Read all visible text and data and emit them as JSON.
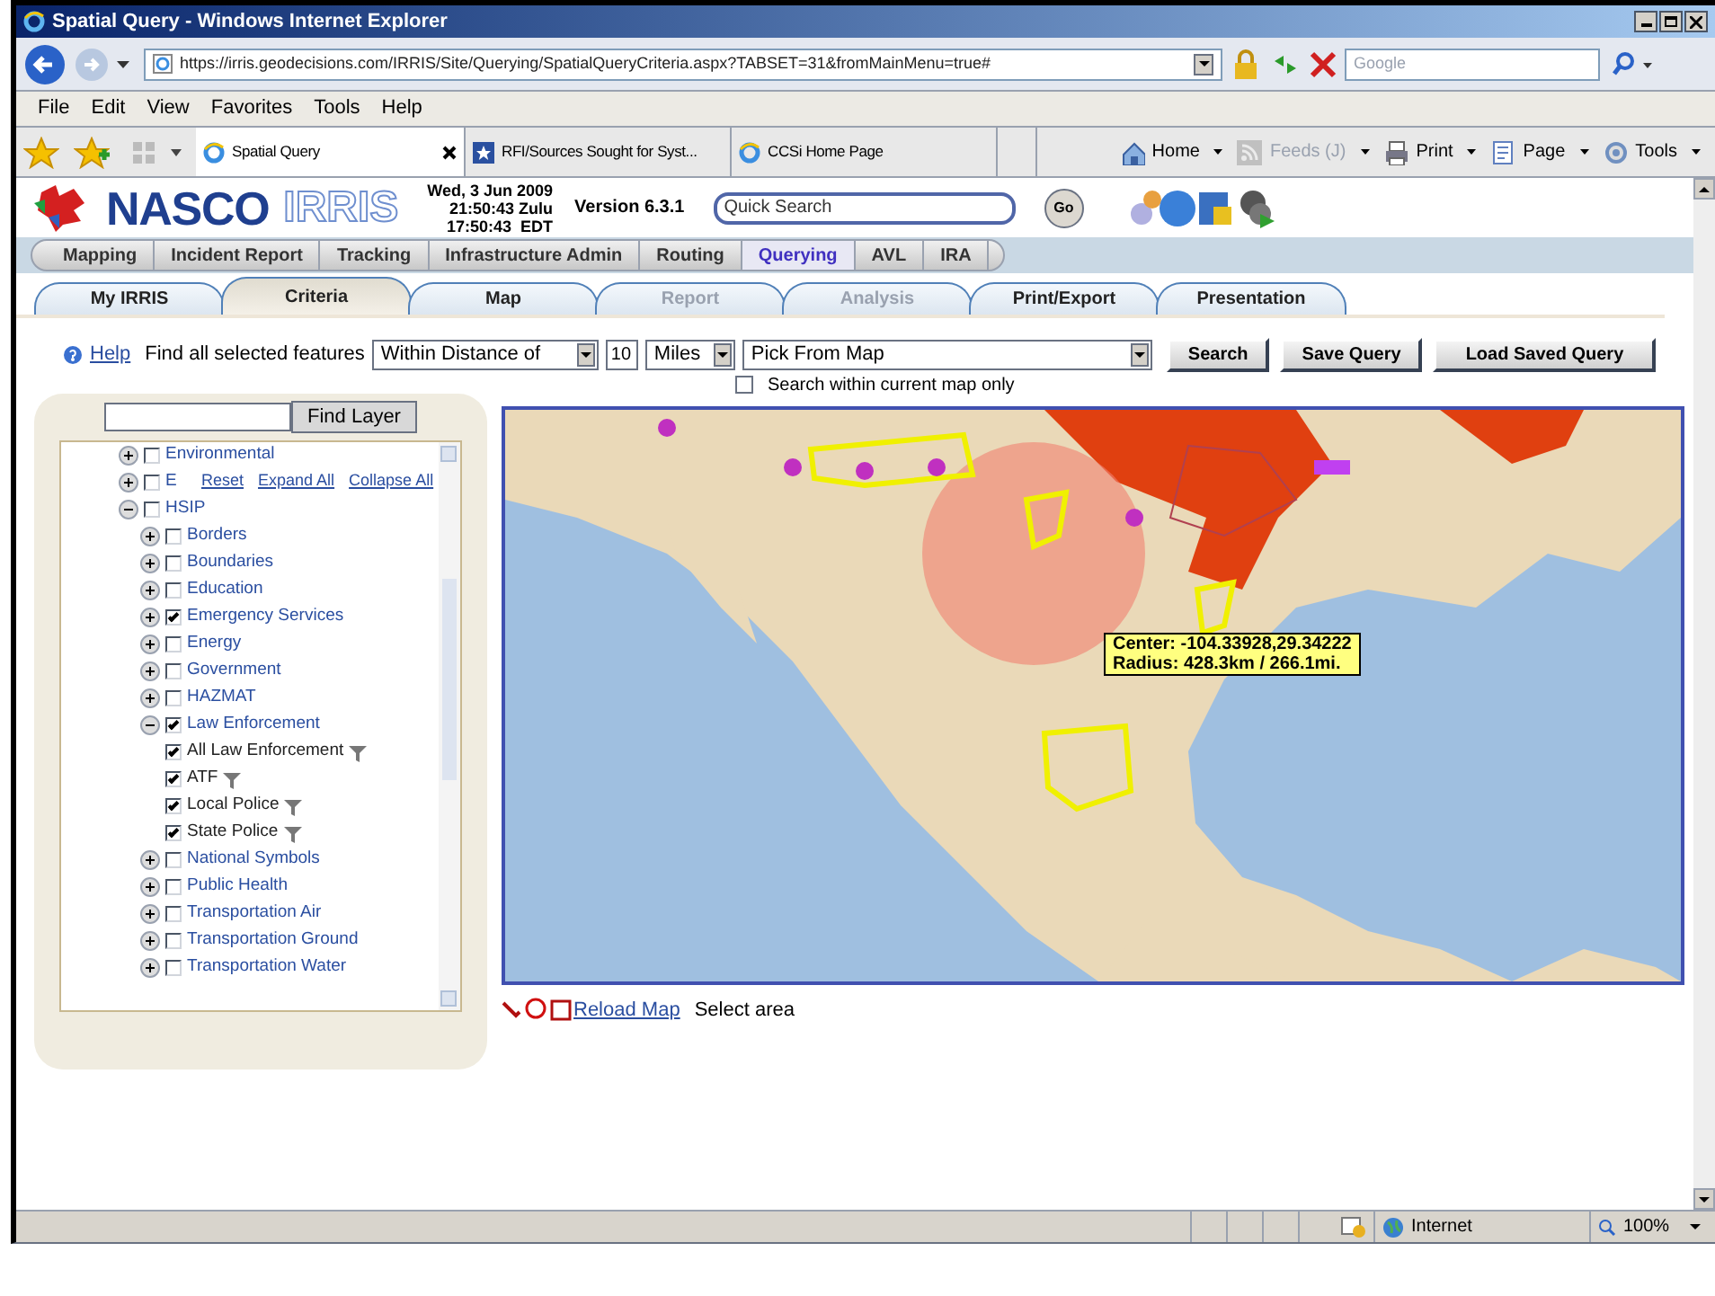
{
  "window": {
    "title": "Spatial Query - Windows Internet Explorer"
  },
  "address_bar": {
    "url": "https://irris.geodecisions.com/IRRIS/Site/Querying/SpatialQueryCriteria.aspx?TABSET=31&fromMainMenu=true#",
    "search_placeholder": "Google"
  },
  "menu": [
    "File",
    "Edit",
    "View",
    "Favorites",
    "Tools",
    "Help"
  ],
  "browser_tabs": [
    {
      "label": "Spatial Query",
      "selected": true
    },
    {
      "label": "RFI/Sources Sought for Syst...",
      "selected": false
    },
    {
      "label": "CCSi Home Page",
      "selected": false
    }
  ],
  "command_bar": [
    {
      "label": "Home",
      "disabled": false
    },
    {
      "label": "Feeds (J)",
      "disabled": true
    },
    {
      "label": "Print",
      "disabled": false
    },
    {
      "label": "Page",
      "disabled": false
    },
    {
      "label": "Tools",
      "disabled": false
    }
  ],
  "header": {
    "logo_text": "NASCO",
    "logo_sub": "IRRIS",
    "date": "Wed, 3 Jun 2009",
    "zulu": "21:50:43 Zulu",
    "local": "17:50:43  EDT",
    "version": "Version 6.3.1",
    "quick_search": "Quick Search",
    "go": "Go"
  },
  "main_nav": [
    {
      "label": "Mapping",
      "selected": false
    },
    {
      "label": "Incident Report",
      "selected": false
    },
    {
      "label": "Tracking",
      "selected": false
    },
    {
      "label": "Infrastructure Admin",
      "selected": false
    },
    {
      "label": "Routing",
      "selected": false
    },
    {
      "label": "Querying",
      "selected": true
    },
    {
      "label": "AVL",
      "selected": false
    },
    {
      "label": "IRA",
      "selected": false
    }
  ],
  "sub_tabs": [
    {
      "label": "My IRRIS",
      "selected": false,
      "disabled": false
    },
    {
      "label": "Criteria",
      "selected": true,
      "disabled": false
    },
    {
      "label": "Map",
      "selected": false,
      "disabled": false
    },
    {
      "label": "Report",
      "selected": false,
      "disabled": true
    },
    {
      "label": "Analysis",
      "selected": false,
      "disabled": true
    },
    {
      "label": "Print/Export",
      "selected": false,
      "disabled": false
    },
    {
      "label": "Presentation",
      "selected": false,
      "disabled": false
    }
  ],
  "query": {
    "help": "Help",
    "prefix": "Find all selected features",
    "operator": "Within Distance of",
    "distance": "10",
    "units": "Miles",
    "target": "Pick From Map",
    "buttons": [
      "Search",
      "Save Query",
      "Load Saved Query"
    ],
    "current_map_only": {
      "label": "Search within current map only",
      "checked": false
    }
  },
  "layer_panel": {
    "find_button": "Find Layer",
    "links": [
      "Reset",
      "Expand All",
      "Collapse All"
    ],
    "tree": [
      {
        "kind": "group",
        "label": "Environmental",
        "expanded": false,
        "checked": false
      },
      {
        "kind": "group",
        "label": "E",
        "expanded": false,
        "checked": false
      },
      {
        "kind": "group",
        "label": "HSIP",
        "expanded": true,
        "checked": false,
        "children": [
          {
            "kind": "group",
            "label": "Borders",
            "expanded": false,
            "checked": false
          },
          {
            "kind": "group",
            "label": "Boundaries",
            "expanded": false,
            "checked": false
          },
          {
            "kind": "group",
            "label": "Education",
            "expanded": false,
            "checked": false
          },
          {
            "kind": "group",
            "label": "Emergency Services",
            "expanded": false,
            "checked": true
          },
          {
            "kind": "group",
            "label": "Energy",
            "expanded": false,
            "checked": false
          },
          {
            "kind": "group",
            "label": "Government",
            "expanded": false,
            "checked": false
          },
          {
            "kind": "group",
            "label": "HAZMAT",
            "expanded": false,
            "checked": false
          },
          {
            "kind": "group",
            "label": "Law Enforcement",
            "expanded": true,
            "checked": true,
            "children": [
              {
                "kind": "layer",
                "label": "All Law Enforcement",
                "checked": true
              },
              {
                "kind": "layer",
                "label": "ATF",
                "checked": true
              },
              {
                "kind": "layer",
                "label": "Local Police",
                "checked": true
              },
              {
                "kind": "layer",
                "label": "State Police",
                "checked": true
              }
            ]
          },
          {
            "kind": "group",
            "label": "National Symbols",
            "expanded": false,
            "checked": false
          },
          {
            "kind": "group",
            "label": "Public Health",
            "expanded": false,
            "checked": false
          },
          {
            "kind": "group",
            "label": "Transportation Air",
            "expanded": false,
            "checked": false
          },
          {
            "kind": "group",
            "label": "Transportation Ground",
            "expanded": false,
            "checked": false
          },
          {
            "kind": "group",
            "label": "Transportation Water",
            "expanded": false,
            "checked": false
          }
        ]
      }
    ]
  },
  "map": {
    "kind": "picture",
    "callout": [
      "Center: -104.33928,29.34222",
      "Radius: 428.3km / 266.1mi."
    ]
  },
  "map_footer": {
    "reload": "Reload Map",
    "mode": "Select area"
  },
  "status_bar": {
    "zone": "Internet",
    "zoom": "100%"
  }
}
